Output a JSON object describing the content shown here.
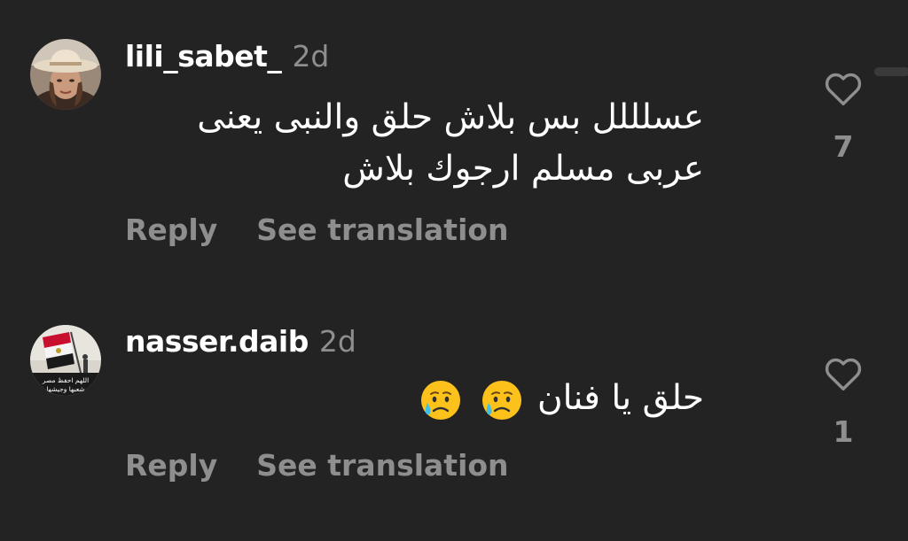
{
  "comments": [
    {
      "username": "lili_sabet_",
      "timestamp": "2d",
      "text_lines": [
        "عسلللل بس بلاش حلق والنبى يعنى",
        "عربى مسلم ارجوك بلاش"
      ],
      "reply_label": "Reply",
      "translate_label": "See translation",
      "like_count": "7"
    },
    {
      "username": "nasser.daib",
      "timestamp": "2d",
      "text": "حلق يا فنان",
      "emojis": [
        "sad-but-relieved-face",
        "sad-but-relieved-face"
      ],
      "avatar_caption_line1": "اللهم احفظ مصر",
      "avatar_caption_line2": "شعبها وجيشها",
      "reply_label": "Reply",
      "translate_label": "See translation",
      "like_count": "1"
    }
  ],
  "colors": {
    "background": "#232323",
    "primary_text": "#ffffff",
    "secondary_text": "#8e8e8e"
  }
}
